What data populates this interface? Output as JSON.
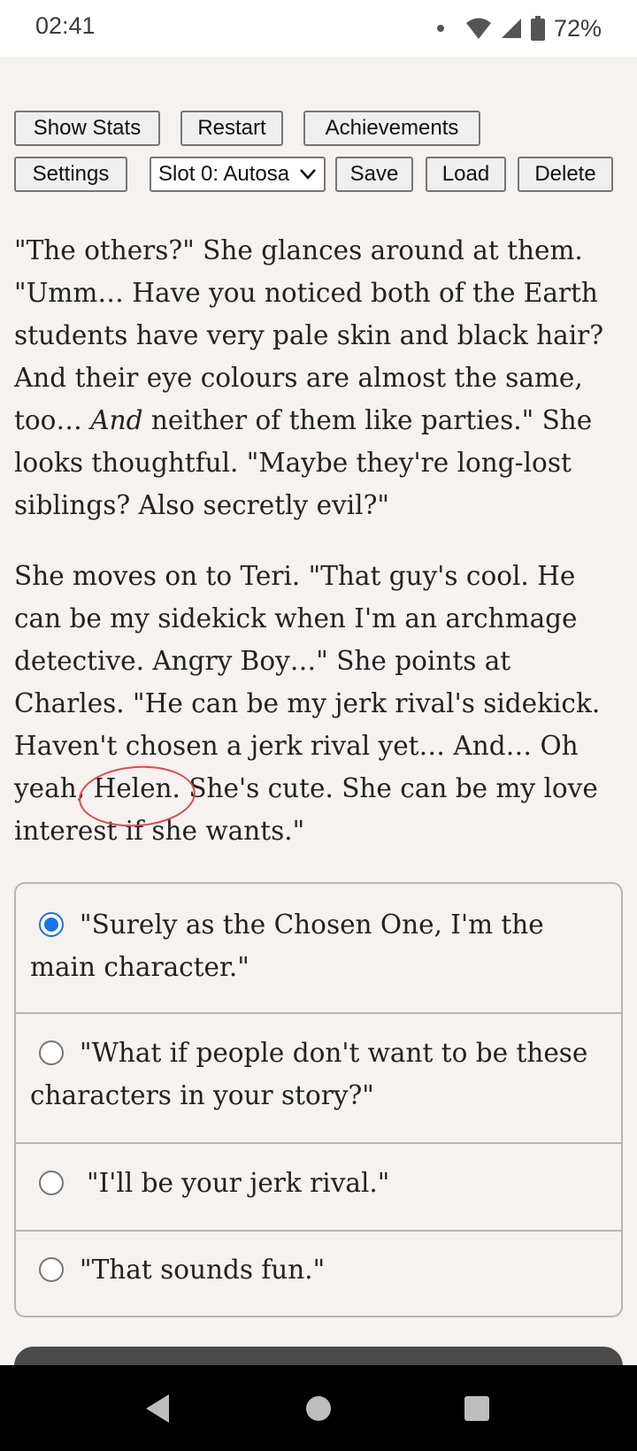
{
  "status": {
    "time": "02:41",
    "battery": "72%"
  },
  "toolbar": {
    "show_stats": "Show Stats",
    "restart": "Restart",
    "achievements": "Achievements",
    "settings": "Settings",
    "slot_selected": "Slot 0: Autosa",
    "save": "Save",
    "load": "Load",
    "delete": "Delete"
  },
  "story": {
    "p1_before": "\"The others?\" She glances around at them. \"Umm… Have you noticed both of the Earth students have very pale skin and black hair? And their eye colours are almost the same, too… ",
    "p1_italic": "And",
    "p1_after": " neither of them like parties.\" She looks thoughtful. \"Maybe they're long-lost siblings? Also secretly evil?\"",
    "p2_before": "She moves on to Teri. \"That guy's cool. He can be my sidekick when I'm an archmage detective. Angry Boy…\" She points at Charles. \"He can be my jerk rival's sidekick. Haven't chosen a jerk rival yet… And… Oh yeah, ",
    "p2_highlight": "Helen.",
    "p2_after": " She's cute. She can be my love interest if she wants.\""
  },
  "choices": [
    {
      "text": "\"Surely as the Chosen One, I'm the main character.\"",
      "selected": true
    },
    {
      "text": "\"What if people don't want to be these characters in your story?\"",
      "selected": false
    },
    {
      "text": "\"I'll be your jerk rival.\"",
      "selected": false
    },
    {
      "text": "\"That sounds fun.\"",
      "selected": false
    }
  ],
  "colors": {
    "accent": "#1a73e8",
    "annotation": "#e0484d"
  }
}
